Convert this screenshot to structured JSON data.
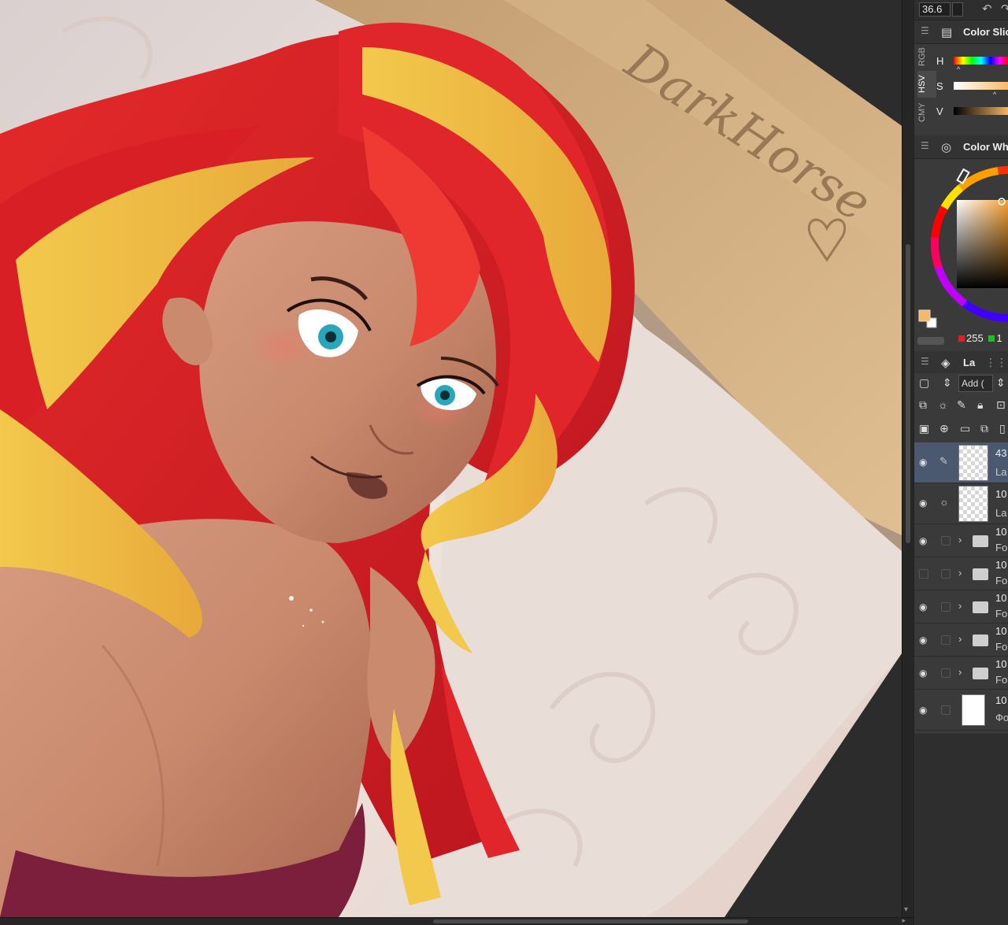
{
  "toolbar": {
    "zoom_value": "36.6",
    "undo_icon": "undo-icon",
    "redo_icon": "redo-icon"
  },
  "color_slider": {
    "title": "Color Slic",
    "tabs": [
      "RGB",
      "HSV",
      "CMY"
    ],
    "active_tab": "HSV",
    "labels": [
      "H",
      "S",
      "V"
    ]
  },
  "color_wheel": {
    "title": "Color Wh",
    "main_color": "#f7b866",
    "sub_color": "#ffffff",
    "r_value": "255",
    "g_value": "1"
  },
  "layer_panel": {
    "title": "La",
    "blend_mode": "Add (",
    "layers": [
      {
        "opacity": "43",
        "name": "La",
        "kind": "raster",
        "visible": true,
        "selected": true
      },
      {
        "opacity": "10",
        "name": "La",
        "kind": "raster",
        "visible": true,
        "selected": false
      },
      {
        "opacity": "10",
        "name": "Fo",
        "kind": "folder",
        "visible": true,
        "selected": false
      },
      {
        "opacity": "10",
        "name": "Fo",
        "kind": "folder",
        "visible": false,
        "selected": false
      },
      {
        "opacity": "10",
        "name": "Fo",
        "kind": "folder",
        "visible": true,
        "selected": false
      },
      {
        "opacity": "10",
        "name": "Fo",
        "kind": "folder",
        "visible": true,
        "selected": false
      },
      {
        "opacity": "10",
        "name": "Fo",
        "kind": "folder",
        "visible": true,
        "selected": false
      },
      {
        "opacity": "10",
        "name": "Фо",
        "kind": "paper",
        "visible": true,
        "selected": false
      }
    ]
  },
  "canvas": {
    "signature": "DarkHorse"
  },
  "colors": {
    "panel_bg": "#3a3a3a",
    "selected_row": "#4a5870",
    "canvas_bg": "#2c2c2c"
  }
}
